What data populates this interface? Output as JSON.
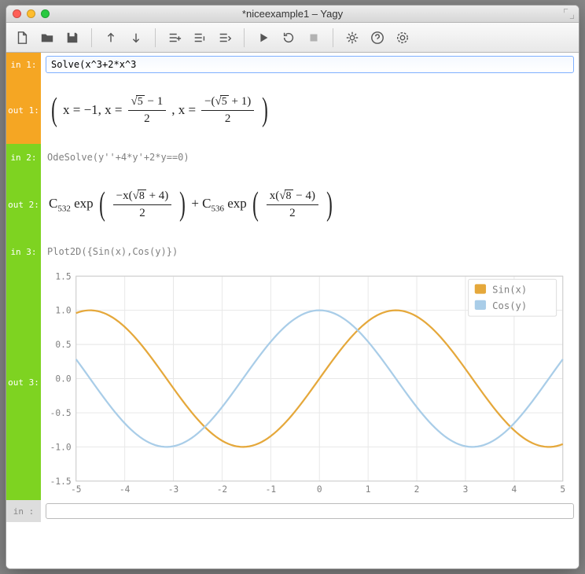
{
  "window": {
    "title": "*niceexample1 – Yagy"
  },
  "toolbar_labels": {
    "new": "New",
    "open": "Open",
    "save": "Save",
    "up": "Insert Above",
    "down": "Insert Below",
    "listplus": "Add Cell",
    "listminus": "Remove Cell",
    "listswap": "Swap",
    "run": "Run",
    "reload": "Restart",
    "stop": "Stop",
    "settings": "Settings",
    "help": "Help",
    "target": "Kernel"
  },
  "cells": {
    "in1": {
      "label": "in  1:",
      "value": "Solve(x^3+2*x^3"
    },
    "out1": {
      "label": "out 1:",
      "text": "( x = −1, x = (√5 − 1)/2 , x = −(√5 + 1)/2 )"
    },
    "in2": {
      "label": "in  2:",
      "code": "OdeSolve(y''+4*y'+2*y==0)"
    },
    "out2": {
      "label": "out 2:",
      "text": "C532 exp( −x(√8 + 4)/2 ) + C536 exp( x(√8 − 4)/2 )"
    },
    "in3": {
      "label": "in  3:",
      "code": "Plot2D({Sin(x),Cos(y)})"
    },
    "out3": {
      "label": "out 3:"
    },
    "in_blank": {
      "label": "in   :",
      "value": ""
    }
  },
  "chart_data": {
    "type": "line",
    "xlim": [
      -5,
      5
    ],
    "ylim": [
      -1.5,
      1.5
    ],
    "xticks": [
      -5,
      -4,
      -3,
      -2,
      -1,
      0,
      1,
      2,
      3,
      4,
      5
    ],
    "yticks": [
      -1.5,
      -1.0,
      -0.5,
      0.0,
      0.5,
      1.0,
      1.5
    ],
    "series": [
      {
        "name": "Sin(x)",
        "color": "#e5a83b",
        "x": [
          -5,
          -4.5,
          -4,
          -3.5,
          -3,
          -2.5,
          -2,
          -1.5,
          -1,
          -0.5,
          0,
          0.5,
          1,
          1.5,
          2,
          2.5,
          3,
          3.5,
          4,
          4.5,
          5
        ],
        "y": [
          0.959,
          0.978,
          0.757,
          0.351,
          -0.141,
          -0.599,
          -0.909,
          -0.997,
          -0.841,
          -0.479,
          0,
          0.479,
          0.841,
          0.997,
          0.909,
          0.599,
          0.141,
          -0.351,
          -0.757,
          -0.978,
          -0.959
        ]
      },
      {
        "name": "Cos(y)",
        "color": "#a9cde8",
        "x": [
          -5,
          -4.5,
          -4,
          -3.5,
          -3,
          -2.5,
          -2,
          -1.5,
          -1,
          -0.5,
          0,
          0.5,
          1,
          1.5,
          2,
          2.5,
          3,
          3.5,
          4,
          4.5,
          5
        ],
        "y": [
          0.284,
          -0.211,
          -0.654,
          -0.936,
          -0.99,
          -0.801,
          -0.416,
          0.071,
          0.54,
          0.878,
          1.0,
          0.878,
          0.54,
          0.071,
          -0.416,
          -0.801,
          -0.99,
          -0.936,
          -0.654,
          -0.211,
          0.284
        ]
      }
    ]
  }
}
